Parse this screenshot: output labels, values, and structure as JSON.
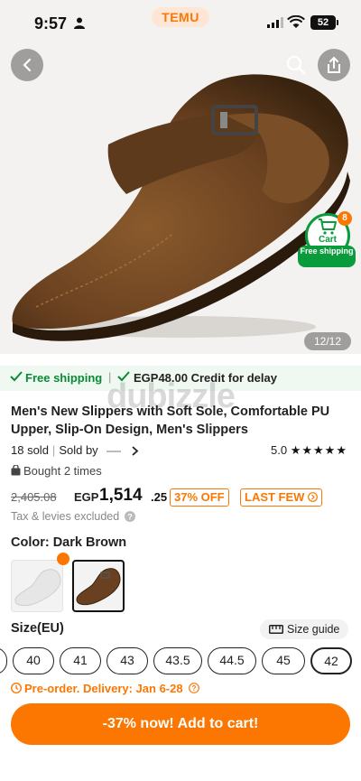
{
  "status_bar": {
    "time": "9:57",
    "app_pill": "TEMU",
    "battery": "52"
  },
  "hero": {
    "image_counter": "12/12",
    "cart_count": "8",
    "cart_label": "Cart",
    "cart_shipping": "Free shipping"
  },
  "shipping_strip": {
    "left": "Free shipping",
    "right": "EGP48.00 Credit for delay"
  },
  "watermark": "dubizzle",
  "product": {
    "title": "Men's New Slippers with Soft Sole, Comfortable PU Upper, Slip-On Design, Men's Slippers",
    "sold": "18 sold",
    "sold_by": "Sold by",
    "rating": "5.0",
    "stars": "★★★★★",
    "bought": "Bought 2 times"
  },
  "price": {
    "old": "2,405.08",
    "currency": "EGP",
    "current": "1,514",
    "decimals": ".25",
    "discount": "37% OFF",
    "tag": "LAST FEW",
    "tax_note": "Tax & levies excluded"
  },
  "color": {
    "label": "Color: Dark Brown",
    "selected": "Dark Brown"
  },
  "size": {
    "label": "Size(EU)",
    "guide": "Size guide",
    "options": [
      "40",
      "41",
      "43",
      "43.5",
      "44.5",
      "45",
      "42"
    ],
    "selected": "42"
  },
  "preorder": "Pre-order. Delivery: Jan 6-28",
  "cta": "-37% now! Add to cart!",
  "colors": {
    "accent": "#fb7701",
    "green": "#0a9c3c"
  }
}
